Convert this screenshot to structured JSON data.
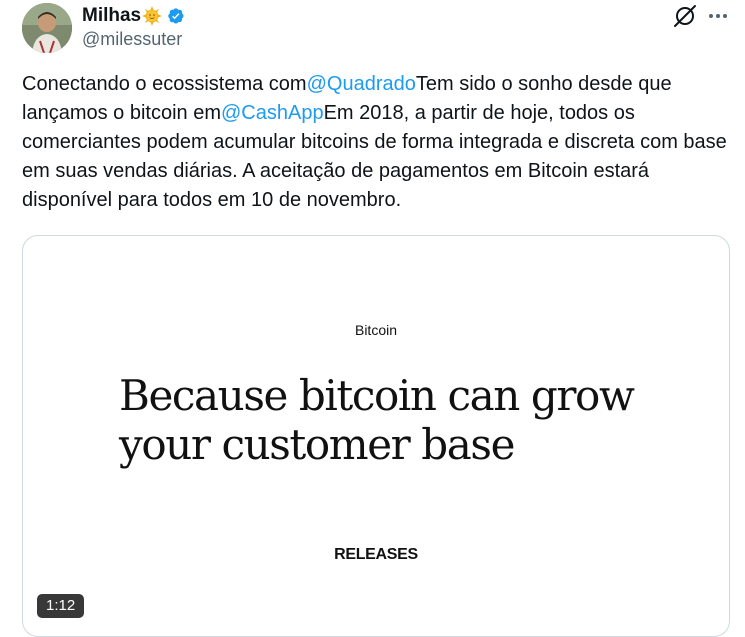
{
  "author": {
    "display_name": "Milhas",
    "name_emoji": "sun-face-emoji",
    "verified_icon": "verified-badge-icon",
    "handle": "@milessuter"
  },
  "actions": {
    "grok_icon": "grok-icon",
    "more_icon": "more-options-icon"
  },
  "tweet": {
    "seg1": "Conectando o ecossistema com",
    "mention1": "@Quadrado",
    "seg2": "Tem sido o sonho desde que lançamos o bitcoin em",
    "mention2": "@CashApp",
    "seg3": "Em 2018, a partir de hoje, todos os comerciantes podem acumular bitcoins de forma integrada e discreta com base em suas vendas diárias. A aceitação de pagamentos em Bitcoin estará disponível para todos em 10 de novembro."
  },
  "media": {
    "label": "Bitcoin",
    "headline": "Because bitcoin can grow your customer base",
    "footer": "RELEASES",
    "duration": "1:12"
  },
  "colors": {
    "accent": "#1d9bf0",
    "text": "#0f1419",
    "secondary": "#536471"
  }
}
